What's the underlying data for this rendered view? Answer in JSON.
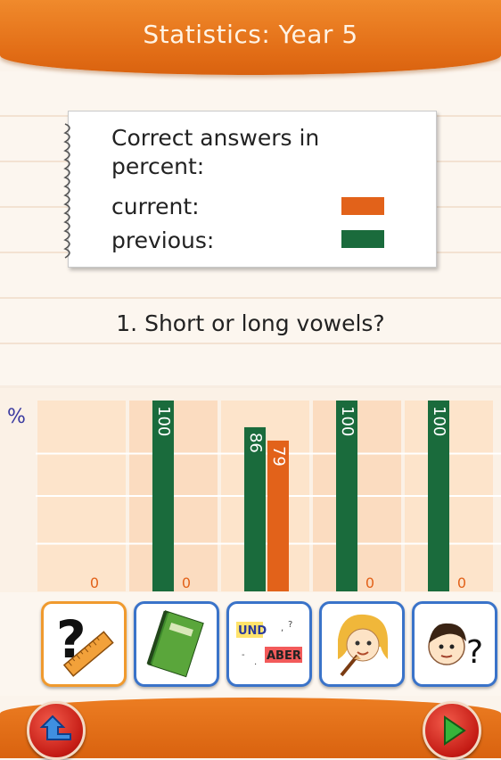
{
  "header": {
    "title": "Statistics: Year 5"
  },
  "legend": {
    "title": "Correct answers in percent:",
    "current_label": "current:",
    "previous_label": "previous:",
    "current_color": "#e2621a",
    "previous_color": "#1a6b3c"
  },
  "question": "1. Short or long vowels?",
  "chart_data": {
    "type": "bar",
    "ylabel": "%",
    "ylim": [
      0,
      100
    ],
    "categories": [
      "1",
      "2",
      "3",
      "4",
      "5"
    ],
    "series": [
      {
        "name": "previous",
        "values": [
          null,
          100,
          86,
          100,
          100
        ]
      },
      {
        "name": "current",
        "values": [
          0,
          0,
          79,
          0,
          0
        ]
      }
    ],
    "grid": true
  },
  "category_buttons": [
    {
      "icon": "question-ruler-icon",
      "active": true
    },
    {
      "icon": "green-book-icon",
      "active": false
    },
    {
      "icon": "und-aber-words-icon",
      "active": false
    },
    {
      "icon": "girl-writing-icon",
      "active": false
    },
    {
      "icon": "boy-question-icon",
      "active": false
    }
  ],
  "category_icon_text": {
    "und": "UND",
    "aber": "ABER"
  },
  "nav": {
    "back_icon": "back-arrow-icon",
    "next_icon": "play-next-icon"
  }
}
